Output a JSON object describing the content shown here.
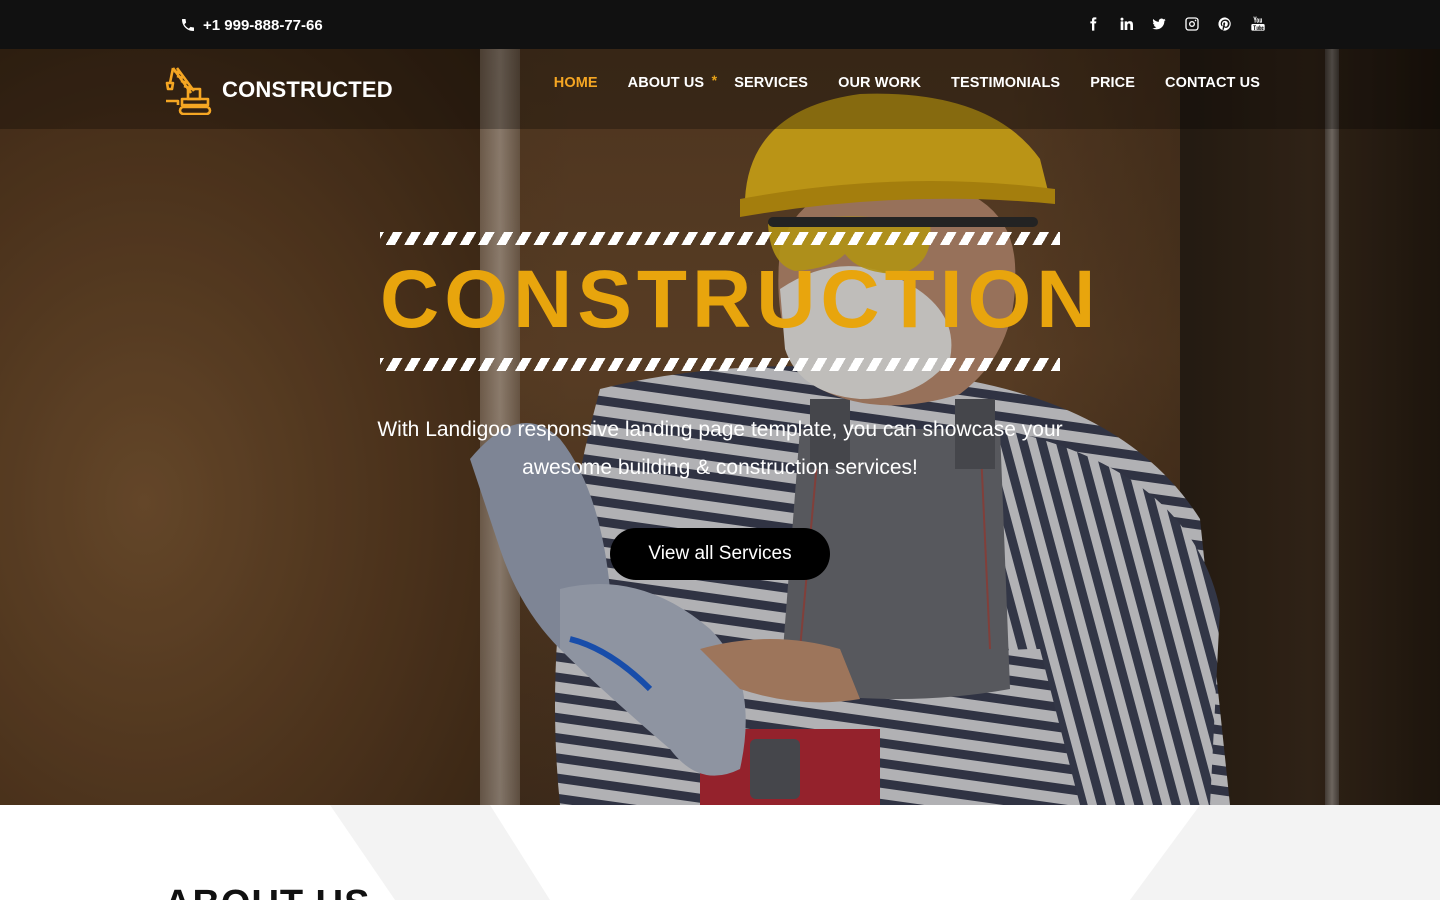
{
  "topbar": {
    "phone": "+1 999-888-77-66",
    "socials": [
      "facebook-icon",
      "linkedin-icon",
      "twitter-icon",
      "instagram-icon",
      "pinterest-icon",
      "youtube-icon"
    ]
  },
  "header": {
    "brand": "CONSTRUCTED",
    "nav": [
      {
        "label": "HOME",
        "active": true
      },
      {
        "label": "ABOUT US",
        "active": false
      },
      {
        "label": "SERVICES",
        "active": false
      },
      {
        "label": "OUR WORK",
        "active": false
      },
      {
        "label": "TESTIMONIALS",
        "active": false
      },
      {
        "label": "PRICE",
        "active": false
      },
      {
        "label": "CONTACT US",
        "active": false
      }
    ],
    "nav_marker": "*"
  },
  "hero": {
    "headline": "CONSTRUCTION",
    "subtext_line1": "With Landigoo responsive landing page template, you can showcase your",
    "subtext_line2": "awesome building & construction services!",
    "cta": "View all Services"
  },
  "about": {
    "title": "ABOUT US"
  },
  "colors": {
    "accent": "#e8a50d",
    "nav_active": "#f5a623",
    "topbar": "#111111",
    "cta_bg": "#000000"
  }
}
